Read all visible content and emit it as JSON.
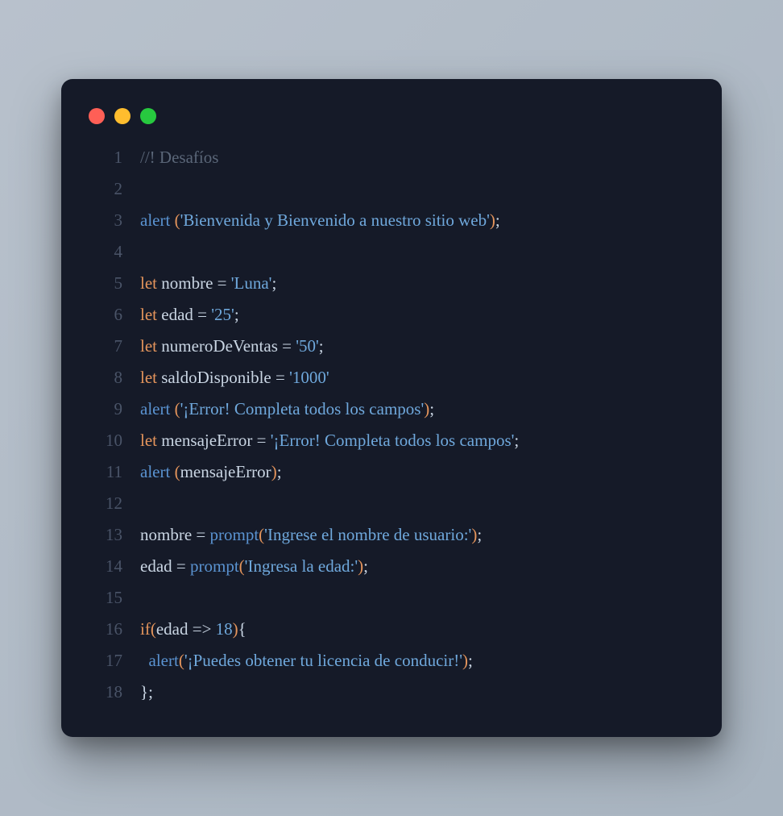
{
  "window_controls": {
    "close": "close",
    "min": "minimize",
    "max": "maximize"
  },
  "colors": {
    "bg": "#151a28",
    "red": "#ff5f56",
    "yellow": "#ffbd2e",
    "green": "#27c93f",
    "comment": "#5a6678",
    "keyword": "#e5955c",
    "func": "#5a93d1",
    "string": "#6fa8dc",
    "number": "#6fa8dc",
    "ident": "#c9d5e3"
  },
  "language": "javascript",
  "code_lines": [
    {
      "n": "1",
      "t": [
        [
          "comment",
          "//! Desafíos"
        ]
      ]
    },
    {
      "n": "2",
      "t": []
    },
    {
      "n": "3",
      "t": [
        [
          "fn",
          "alert"
        ],
        [
          "id",
          " "
        ],
        [
          "paren",
          "("
        ],
        [
          "str",
          "'Bienvenida y Bienvenido a nuestro sitio web'"
        ],
        [
          "paren",
          ")"
        ],
        [
          "id",
          ";"
        ]
      ]
    },
    {
      "n": "4",
      "t": []
    },
    {
      "n": "5",
      "t": [
        [
          "kw",
          "let"
        ],
        [
          "id",
          " nombre "
        ],
        [
          "op",
          "="
        ],
        [
          "id",
          " "
        ],
        [
          "str",
          "'Luna'"
        ],
        [
          "id",
          ";"
        ]
      ]
    },
    {
      "n": "6",
      "t": [
        [
          "kw",
          "let"
        ],
        [
          "id",
          " edad "
        ],
        [
          "op",
          "="
        ],
        [
          "id",
          " "
        ],
        [
          "str",
          "'25'"
        ],
        [
          "id",
          ";"
        ]
      ]
    },
    {
      "n": "7",
      "t": [
        [
          "kw",
          "let"
        ],
        [
          "id",
          " numeroDeVentas "
        ],
        [
          "op",
          "="
        ],
        [
          "id",
          " "
        ],
        [
          "str",
          "'50'"
        ],
        [
          "id",
          ";"
        ]
      ]
    },
    {
      "n": "8",
      "t": [
        [
          "kw",
          "let"
        ],
        [
          "id",
          " saldoDisponible "
        ],
        [
          "op",
          "="
        ],
        [
          "id",
          " "
        ],
        [
          "str",
          "'1000'"
        ]
      ]
    },
    {
      "n": "9",
      "t": [
        [
          "fn",
          "alert"
        ],
        [
          "id",
          " "
        ],
        [
          "paren",
          "("
        ],
        [
          "str",
          "'¡Error! Completa todos los campos'"
        ],
        [
          "paren",
          ")"
        ],
        [
          "id",
          ";"
        ]
      ]
    },
    {
      "n": "10",
      "t": [
        [
          "kw",
          "let"
        ],
        [
          "id",
          " mensajeError "
        ],
        [
          "op",
          "="
        ],
        [
          "id",
          " "
        ],
        [
          "str",
          "'¡Error! Completa todos los campos'"
        ],
        [
          "id",
          ";"
        ]
      ]
    },
    {
      "n": "11",
      "t": [
        [
          "fn",
          "alert"
        ],
        [
          "id",
          " "
        ],
        [
          "paren",
          "("
        ],
        [
          "id",
          "mensajeError"
        ],
        [
          "paren",
          ")"
        ],
        [
          "id",
          ";"
        ]
      ]
    },
    {
      "n": "12",
      "t": []
    },
    {
      "n": "13",
      "t": [
        [
          "id",
          "nombre "
        ],
        [
          "op",
          "="
        ],
        [
          "id",
          " "
        ],
        [
          "fn",
          "prompt"
        ],
        [
          "paren",
          "("
        ],
        [
          "str",
          "'Ingrese el nombre de usuario:'"
        ],
        [
          "paren",
          ")"
        ],
        [
          "id",
          ";"
        ]
      ]
    },
    {
      "n": "14",
      "t": [
        [
          "id",
          "edad "
        ],
        [
          "op",
          "="
        ],
        [
          "id",
          " "
        ],
        [
          "fn",
          "prompt"
        ],
        [
          "paren",
          "("
        ],
        [
          "str",
          "'Ingresa la edad:'"
        ],
        [
          "paren",
          ")"
        ],
        [
          "id",
          ";"
        ]
      ]
    },
    {
      "n": "15",
      "t": []
    },
    {
      "n": "16",
      "t": [
        [
          "kw",
          "if"
        ],
        [
          "paren",
          "("
        ],
        [
          "id",
          "edad "
        ],
        [
          "op",
          "=>"
        ],
        [
          "id",
          " "
        ],
        [
          "num",
          "18"
        ],
        [
          "paren",
          ")"
        ],
        [
          "id",
          "{"
        ]
      ]
    },
    {
      "n": "17",
      "t": [
        [
          "id",
          "  "
        ],
        [
          "fn",
          "alert"
        ],
        [
          "paren",
          "("
        ],
        [
          "str",
          "'¡Puedes obtener tu licencia de conducir!'"
        ],
        [
          "paren",
          ")"
        ],
        [
          "id",
          ";"
        ]
      ]
    },
    {
      "n": "18",
      "t": [
        [
          "id",
          "};"
        ]
      ]
    }
  ]
}
